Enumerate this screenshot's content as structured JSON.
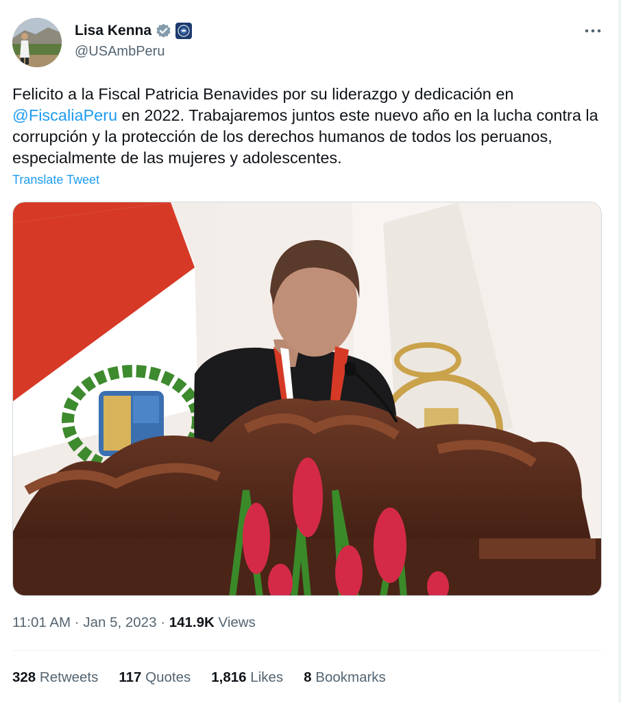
{
  "author": {
    "name": "Lisa Kenna",
    "handle": "@USAmbPeru",
    "verified": true,
    "verified_color": "#829aab",
    "avatar_icon": "profile-photo",
    "affiliation_badge_icon": "us-government-seal-icon"
  },
  "more_icon": "more-options-icon",
  "tweet": {
    "text_before": "Felicito a la Fiscal Patricia Benavides por su liderazgo y dedicación en ",
    "mention": "@FiscaliaPeru",
    "text_after": " en 2022. Trabajaremos juntos este nuevo año en la lucha contra la corrupción y la protección de los derechos humanos de todos los peruanos, especialmente de las mujeres y adolescentes.",
    "translate_label": "Translate Tweet"
  },
  "media": {
    "icon": "photo-woman-at-carved-podium-with-peru-flag"
  },
  "meta": {
    "time": "11:01 AM",
    "separator": "·",
    "date": "Jan 5, 2023",
    "views_count": "141.9K",
    "views_label": "Views"
  },
  "stats": [
    {
      "count": "328",
      "label": "Retweets"
    },
    {
      "count": "117",
      "label": "Quotes"
    },
    {
      "count": "1,816",
      "label": "Likes"
    },
    {
      "count": "8",
      "label": "Bookmarks"
    }
  ],
  "colors": {
    "link": "#1d9bf0",
    "secondary_text": "#536471",
    "primary_text": "#0f1419",
    "divider": "#eff3f4"
  }
}
